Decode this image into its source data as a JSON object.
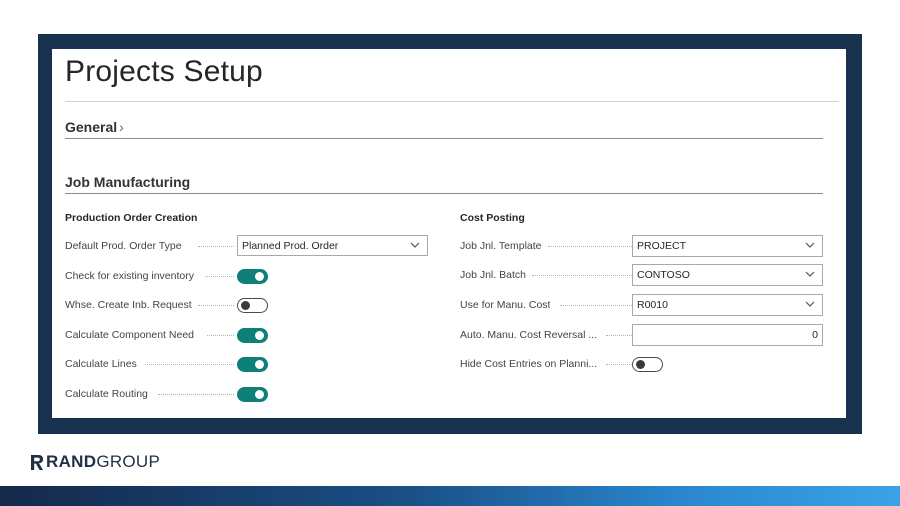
{
  "page_title": "Projects Setup",
  "sections": {
    "general": {
      "label": "General",
      "chevron": "›"
    },
    "job_manufacturing": {
      "label": "Job Manufacturing"
    }
  },
  "production_order_creation": {
    "title": "Production Order Creation",
    "default_type": {
      "label": "Default Prod. Order Type",
      "value": "Planned Prod. Order"
    },
    "check_existing_inventory": {
      "label": "Check for existing inventory",
      "on": true
    },
    "whse_create_inb_request": {
      "label": "Whse. Create Inb. Request",
      "on": false
    },
    "calculate_component_need": {
      "label": "Calculate Component Need",
      "on": true
    },
    "calculate_lines": {
      "label": "Calculate Lines",
      "on": true
    },
    "calculate_routing": {
      "label": "Calculate Routing",
      "on": true
    }
  },
  "cost_posting": {
    "title": "Cost Posting",
    "job_jnl_template": {
      "label": "Job Jnl. Template",
      "value": "PROJECT"
    },
    "job_jnl_batch": {
      "label": "Job Jnl. Batch",
      "value": "CONTOSO"
    },
    "use_for_manu_cost": {
      "label": "Use for Manu. Cost",
      "value": "R0010"
    },
    "auto_manu_cost_reversal": {
      "label": "Auto. Manu. Cost Reversal ...",
      "value": "0"
    },
    "hide_cost_entries": {
      "label": "Hide Cost Entries on Planni...",
      "on": false
    }
  },
  "branding": {
    "logo_letter": "R",
    "logo_bold": "RAND",
    "logo_light": "GROUP"
  },
  "colors": {
    "frame": "#16324f",
    "toggle_on": "#0f7f7a",
    "bar_start": "#15294a",
    "bar_end": "#3aa3e6"
  },
  "icons": {
    "dropdown": "chevron-down-icon",
    "section_expand": "chevron-right-icon"
  }
}
